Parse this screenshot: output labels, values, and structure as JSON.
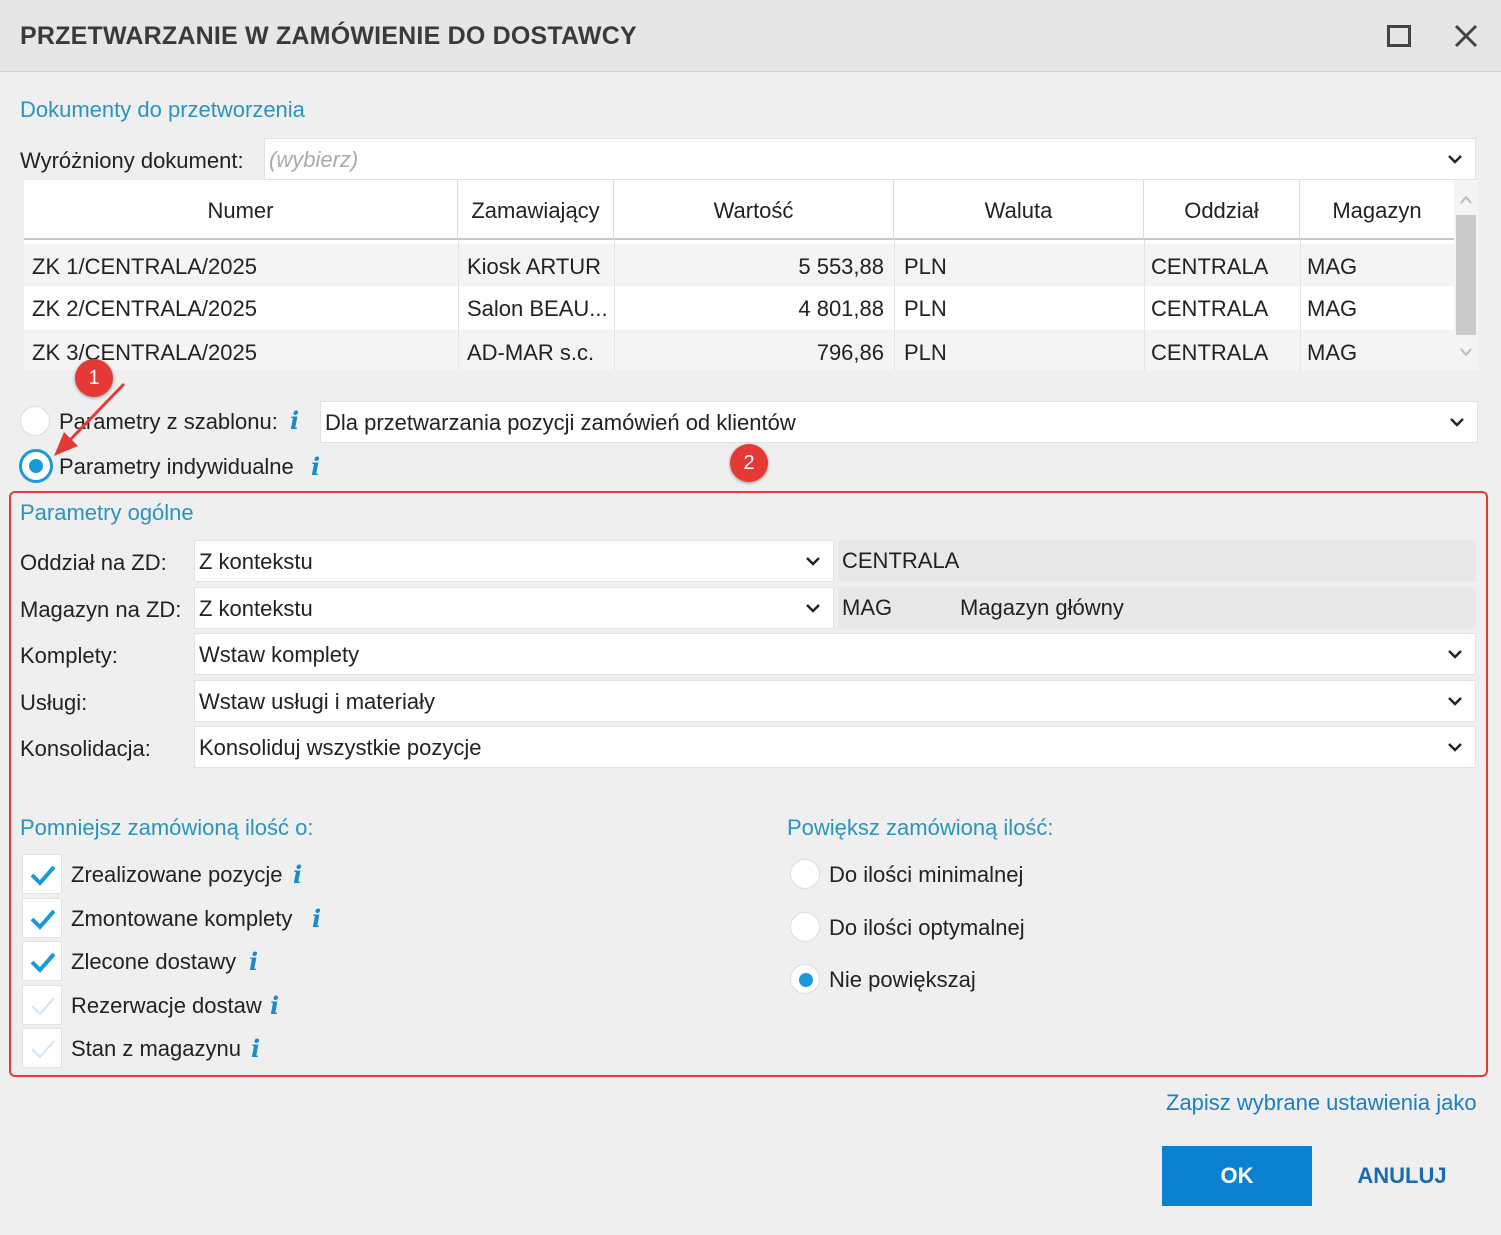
{
  "window": {
    "title": "PRZETWARZANIE W ZAMÓWIENIE DO DOSTAWCY"
  },
  "documents": {
    "section_title": "Dokumenty do przetworzenia",
    "highlighted_label": "Wyróżniony dokument:",
    "highlighted_placeholder": "(wybierz)",
    "columns": [
      "Numer",
      "Zamawiający",
      "Wartość",
      "Waluta",
      "Oddział",
      "Magazyn"
    ],
    "rows": [
      [
        "ZK 1/CENTRALA/2025",
        "Kiosk ARTUR",
        "5 553,88",
        "PLN",
        "CENTRALA",
        "MAG"
      ],
      [
        "ZK 2/CENTRALA/2025",
        "Salon BEAU...",
        "4 801,88",
        "PLN",
        "CENTRALA",
        "MAG"
      ],
      [
        "ZK 3/CENTRALA/2025",
        "AD-MAR s.c.",
        "796,86",
        "PLN",
        "CENTRALA",
        "MAG"
      ]
    ]
  },
  "mode": {
    "template_label": "Parametry z szablonu:",
    "template_value": "Dla przetwarzania pozycji zamówień od klientów",
    "individual_label": "Parametry indywidualne",
    "selected": "individual"
  },
  "annotations": {
    "badge1": "1",
    "badge2": "2"
  },
  "general": {
    "section_title": "Parametry ogólne",
    "branch_label": "Oddział na ZD:",
    "branch_value": "Z kontekstu",
    "branch_ro": "CENTRALA",
    "warehouse_label": "Magazyn na ZD:",
    "warehouse_value": "Z kontekstu",
    "warehouse_code": "MAG",
    "warehouse_name": "Magazyn główny",
    "sets_label": "Komplety:",
    "sets_value": "Wstaw komplety",
    "services_label": "Usługi:",
    "services_value": "Wstaw usługi i materiały",
    "consolidation_label": "Konsolidacja:",
    "consolidation_value": "Konsoliduj wszystkie pozycje"
  },
  "reduce": {
    "title": "Pomniejsz zamówioną ilość o:",
    "items": [
      {
        "label": "Zrealizowane pozycje",
        "checked": true
      },
      {
        "label": "Zmontowane komplety",
        "checked": true
      },
      {
        "label": "Zlecone dostawy",
        "checked": true
      },
      {
        "label": "Rezerwacje dostaw",
        "checked": false
      },
      {
        "label": "Stan z magazynu",
        "checked": false
      }
    ]
  },
  "increase": {
    "title": "Powiększ zamówioną ilość:",
    "options": [
      "Do ilości minimalnej",
      "Do ilości optymalnej",
      "Nie powiększaj"
    ],
    "selected": "Nie powiększaj"
  },
  "footer": {
    "save_link": "Zapisz wybrane ustawienia jako",
    "ok_label": "OK",
    "cancel_label": "ANULUJ"
  },
  "colors": {
    "accent": "#2a94bf",
    "primary_button": "#0a82cf",
    "annotation_red": "#e53935"
  }
}
